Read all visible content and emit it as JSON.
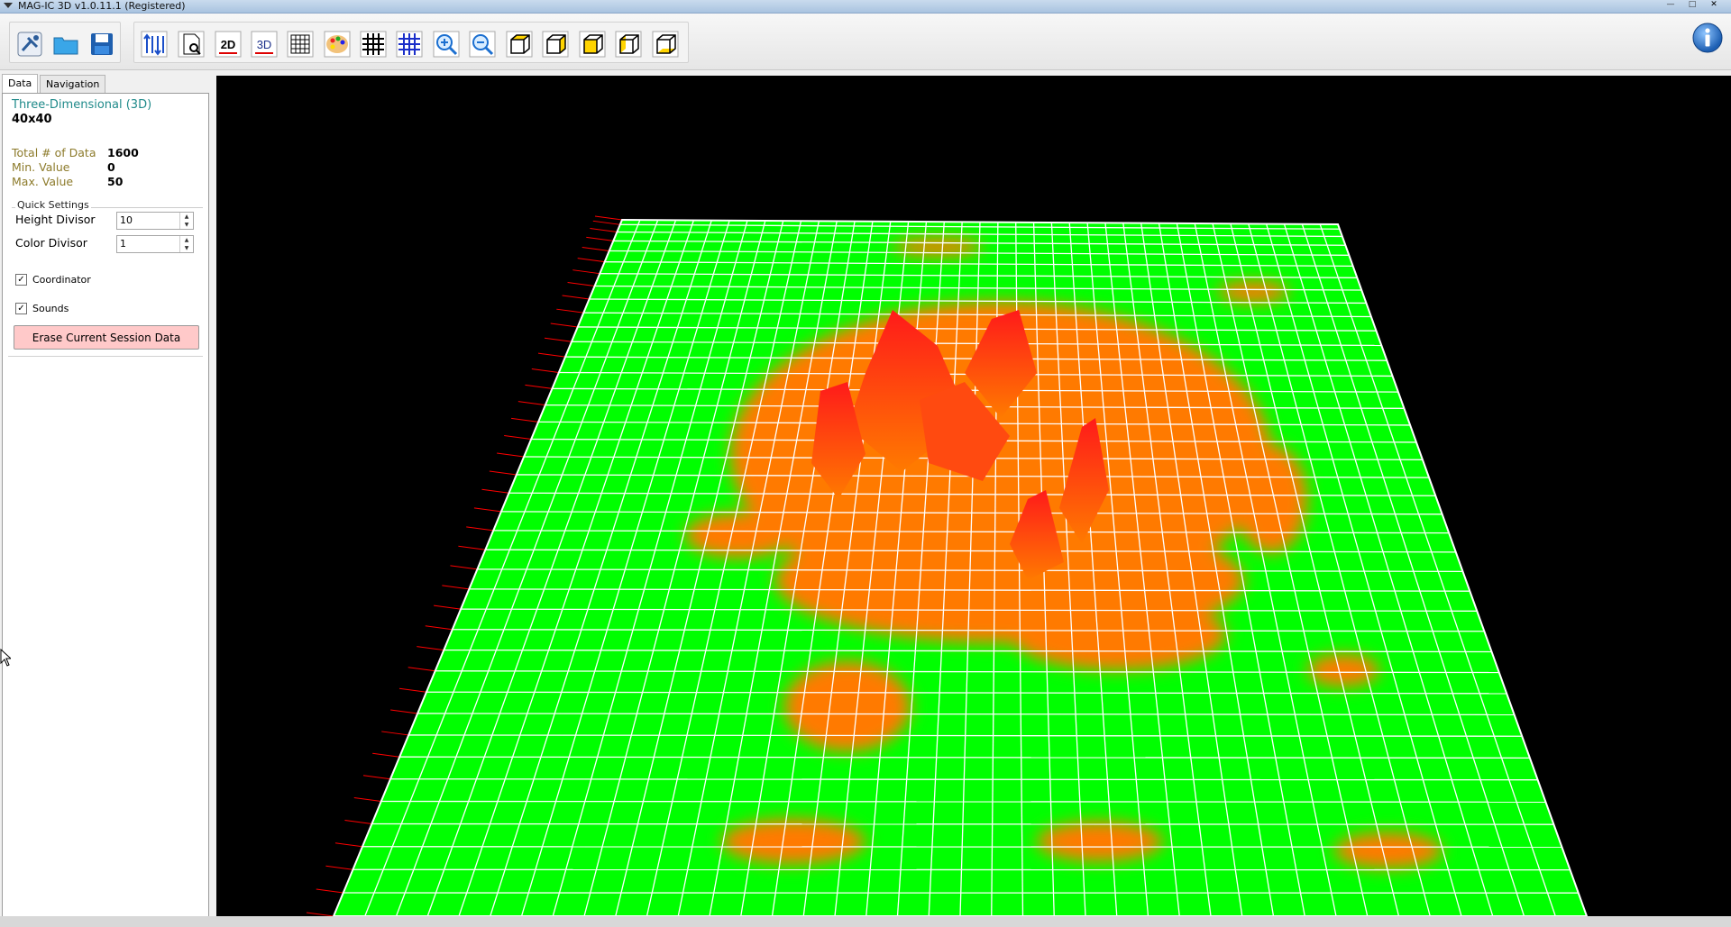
{
  "window": {
    "title": "MAG-IC 3D v1.0.11.1 (Registered)",
    "controls": [
      "minimize",
      "maximize",
      "close"
    ]
  },
  "toolbar": {
    "buttons": [
      {
        "name": "connect-device-icon"
      },
      {
        "name": "open-folder-icon"
      },
      {
        "name": "save-icon"
      },
      {
        "name": "axis-arrows-icon"
      },
      {
        "name": "document-search-icon"
      },
      {
        "name": "view-2d-icon",
        "label": "2D"
      },
      {
        "name": "view-3d-icon",
        "label": "3D"
      },
      {
        "name": "grid-table-icon"
      },
      {
        "name": "color-palette-icon"
      },
      {
        "name": "grid-black-icon"
      },
      {
        "name": "grid-blue-icon"
      },
      {
        "name": "zoom-in-icon"
      },
      {
        "name": "zoom-out-icon"
      },
      {
        "name": "cube-view-1-icon"
      },
      {
        "name": "cube-view-2-icon"
      },
      {
        "name": "cube-view-3-icon"
      },
      {
        "name": "cube-view-4-icon"
      },
      {
        "name": "cube-view-5-icon"
      }
    ],
    "info_icon": "info-icon"
  },
  "tabs": [
    {
      "label": "Data",
      "active": true
    },
    {
      "label": "Navigation",
      "active": false
    }
  ],
  "data_panel": {
    "type": "Three-Dimensional (3D)",
    "dimensions": "40x40",
    "stats": [
      {
        "label": "Total # of Data",
        "value": "1600"
      },
      {
        "label": "Min. Value",
        "value": "0"
      },
      {
        "label": "Max. Value",
        "value": "50"
      }
    ],
    "quick_settings": {
      "legend": "Quick Settings",
      "height_divisor": {
        "label": "Height Divisor",
        "value": "10"
      },
      "color_divisor": {
        "label": "Color Divisor",
        "value": "1"
      }
    },
    "checkboxes": [
      {
        "label": "Coordinator",
        "checked": true
      },
      {
        "label": "Sounds",
        "checked": true
      }
    ],
    "erase_button": "Erase Current Session Data"
  },
  "surface": {
    "grid_size": 40,
    "min_value": 0,
    "max_value": 50,
    "colors": {
      "low": "#00ff00",
      "mid": "#ff7a00",
      "high": "#ff1a1a",
      "grid": "#ffffff",
      "background": "#000000",
      "axis_ticks": "#ff0000"
    }
  }
}
